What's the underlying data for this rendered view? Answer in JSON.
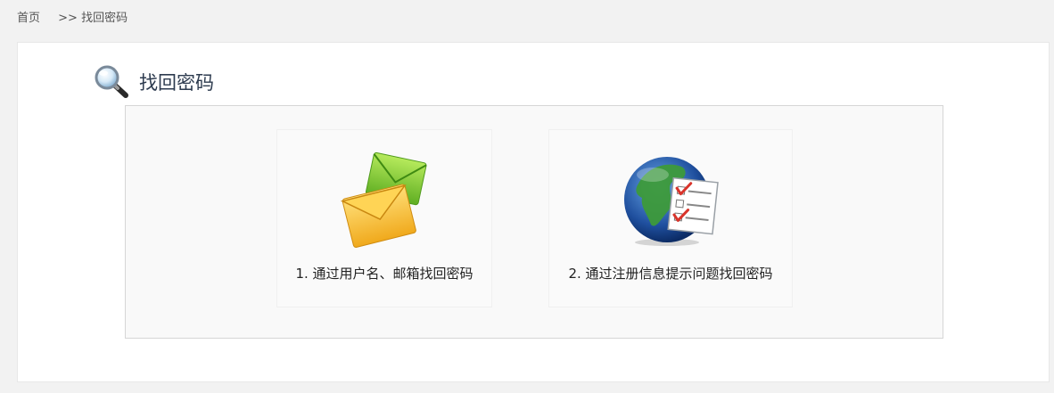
{
  "breadcrumb": {
    "home": "首页",
    "separator": ">>",
    "current": "找回密码"
  },
  "page": {
    "title": "找回密码",
    "title_icon": "magnifier-icon"
  },
  "options": [
    {
      "label": "1. 通过用户名、邮箱找回密码",
      "icon": "envelope-icon"
    },
    {
      "label": "2. 通过注册信息提示问题找回密码",
      "icon": "globe-checklist-icon"
    }
  ],
  "colors": {
    "background": "#f2f2f2",
    "panel": "#ffffff",
    "title": "#2d3b4f",
    "envelope_front": "#f7c43a",
    "envelope_back": "#8fd13f",
    "check": "#d9342b"
  }
}
